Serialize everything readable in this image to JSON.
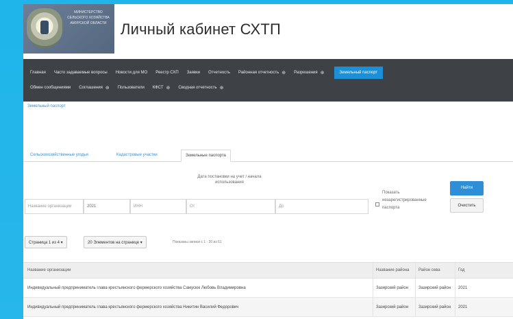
{
  "header": {
    "ministry_name": "МИНИСТЕРСТВО СЕЛЬСКОГО ХОЗЯЙСТВА АМУРСКОЙ ОБЛАСТИ",
    "site_title": "Личный кабинет СХТП"
  },
  "nav": {
    "row1": [
      {
        "label": "Главная",
        "plus": false
      },
      {
        "label": "Часто задаваемые вопросы",
        "plus": false
      },
      {
        "label": "Новости для МО",
        "plus": false
      },
      {
        "label": "Реестр СХП",
        "plus": false
      },
      {
        "label": "Заявки",
        "plus": false
      },
      {
        "label": "Отчетность",
        "plus": false
      },
      {
        "label": "Районная отчетность",
        "plus": true
      },
      {
        "label": "Разрешения",
        "plus": true
      }
    ],
    "active": "Земельный паспорт",
    "row2": [
      {
        "label": "Обмен сообщениями",
        "plus": false
      },
      {
        "label": "Соглашения",
        "plus": true
      },
      {
        "label": "Пользователи",
        "plus": false
      },
      {
        "label": "КФСТ",
        "plus": true
      },
      {
        "label": "Сводная отчетность",
        "plus": true
      }
    ],
    "plus_glyph": "⊕"
  },
  "breadcrumb": "Земельный паспорт",
  "tabs": [
    {
      "label": "Сельскохозяйственные угодья",
      "active": false
    },
    {
      "label": "Кадастровые участки",
      "active": false
    },
    {
      "label": "Земельные паспорта",
      "active": true
    }
  ],
  "filters": {
    "date_caption": "Дата постановки на учет / начала использования",
    "org_name_placeholder": "Название организации",
    "year_value": "2021",
    "inn_placeholder": "ИНН",
    "date_from": "От",
    "date_to": "До",
    "show_unregistered_label": "Показать незарегистрированные паспорта",
    "find_button": "Найти",
    "clear_button": "Очистить"
  },
  "pager": {
    "page_button": "Страница 1 из 4 ▾",
    "per_page_button": "20 Элементов на странице ▾",
    "records_info": "Показаны записи с 1 - 20 из 61"
  },
  "table": {
    "headers": [
      "Название организации",
      "Название района",
      "Район сева",
      "Год"
    ],
    "rows": [
      [
        "Индивидуальный предприниматель глава крестьянского фермерского хозяйства Самусюк Любовь Владимировна",
        "Зазирский район",
        "Зазирский район",
        "2021"
      ],
      [
        "Индивидуальный предприниматель глава крестьянского фермерского хозяйства Никитин Василий Федорович",
        "Зазирский район",
        "Зазирский район",
        "2021"
      ]
    ]
  },
  "colors": {
    "background": "#1fb5ea",
    "nav_bg": "#3e4146",
    "accent": "#1c90d6",
    "link": "#3b8fd0"
  }
}
